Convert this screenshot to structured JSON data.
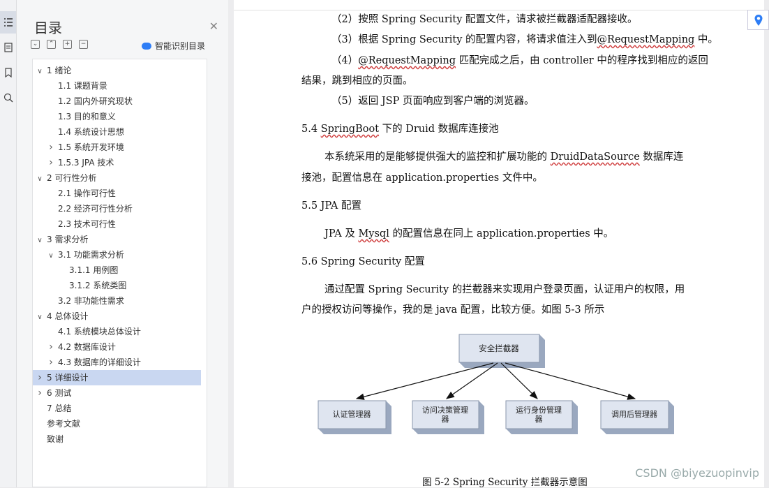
{
  "nav": {
    "title": "目录",
    "ai_label": "智能识别目录",
    "items": [
      {
        "label": "1 绪论",
        "lvl": 0,
        "caret": "down"
      },
      {
        "label": "1.1 课题背景",
        "lvl": 1,
        "caret": ""
      },
      {
        "label": "1.2  国内外研究现状",
        "lvl": 1,
        "caret": ""
      },
      {
        "label": "1.3  目的和意义",
        "lvl": 1,
        "caret": ""
      },
      {
        "label": "1.4  系统设计思想",
        "lvl": 1,
        "caret": ""
      },
      {
        "label": "1.5  系统开发环境",
        "lvl": 1,
        "caret": "right"
      },
      {
        "label": "1.5.3    JPA 技术",
        "lvl": 1,
        "caret": "right"
      },
      {
        "label": "2 可行性分析",
        "lvl": 0,
        "caret": "down"
      },
      {
        "label": "2.1  操作可行性",
        "lvl": 1,
        "caret": ""
      },
      {
        "label": "2.2  经济可行性分析",
        "lvl": 1,
        "caret": ""
      },
      {
        "label": "2.3  技术可行性",
        "lvl": 1,
        "caret": ""
      },
      {
        "label": "3 需求分析",
        "lvl": 0,
        "caret": "down"
      },
      {
        "label": "3.1  功能需求分析",
        "lvl": 1,
        "caret": "down"
      },
      {
        "label": "3.1.1  用例图",
        "lvl": 2,
        "caret": ""
      },
      {
        "label": "3.1.2  系统类图",
        "lvl": 2,
        "caret": ""
      },
      {
        "label": "3.2  非功能性需求",
        "lvl": 1,
        "caret": ""
      },
      {
        "label": "4 总体设计",
        "lvl": 0,
        "caret": "down"
      },
      {
        "label": "4.1  系统模块总体设计",
        "lvl": 1,
        "caret": ""
      },
      {
        "label": "4.2  数据库设计",
        "lvl": 1,
        "caret": "right"
      },
      {
        "label": "4.3 数据库的详细设计",
        "lvl": 1,
        "caret": "right"
      },
      {
        "label": "5 详细设计",
        "lvl": 0,
        "caret": "right",
        "selected": true
      },
      {
        "label": "6 测试",
        "lvl": 0,
        "caret": "right"
      },
      {
        "label": "7 总结",
        "lvl": 0,
        "caret": ""
      },
      {
        "label": "参考文献",
        "lvl": 0,
        "caret": ""
      },
      {
        "label": "致谢",
        "lvl": 0,
        "caret": ""
      }
    ]
  },
  "doc": {
    "l1": "（2）按照 Spring Security 配置文件，请求被拦截器适配器接收。",
    "l2a": "（3）根据 Spring Security 的配置内容，将请求值注入到",
    "l2b": "@RequestMapping",
    "l2c": " 中。",
    "l3a": "（4）",
    "l3b": "@RequestMapping",
    "l3c": " 匹配完成之后，由 controller 中的程序找到相应的返回",
    "l4": "结果，跳到相应的页面。",
    "l5": "（5）返回 JSP 页面响应到客户端的浏览器。",
    "h54a": "5.4 ",
    "h54b": "SpringBoot",
    "h54c": " 下的 Druid 数据库连接池",
    "p54a_1": "本系统采用的是能够提供强大的监控和扩展功能的 ",
    "p54a_2": "DruidDataSource",
    "p54a_3": " 数据库连",
    "p54b": "接池，配置信息在 application.properties 文件中。",
    "h55": "5.5 JPA 配置",
    "p55a": "JPA 及 ",
    "p55b": "Mysql",
    "p55c": " 的配置信息在同上 application.properties 中。",
    "h56": "5.6 Spring Security 配置",
    "p56a": "通过配置 Spring Security 的拦截器来实现用户登录页面，认证用户的权限，用",
    "p56b": "户的授权访问等操作，我的是 java 配置，比较方便。如图 5-3 所示",
    "diagram": {
      "root": "安全拦截器",
      "children": [
        "认证管理器",
        "访问决策管理器",
        "运行身份管理器",
        "调用后管理器"
      ]
    },
    "caption": "图 5-2      Spring Security 拦截器示意图"
  },
  "watermark": "CSDN @biyezuopinvip"
}
